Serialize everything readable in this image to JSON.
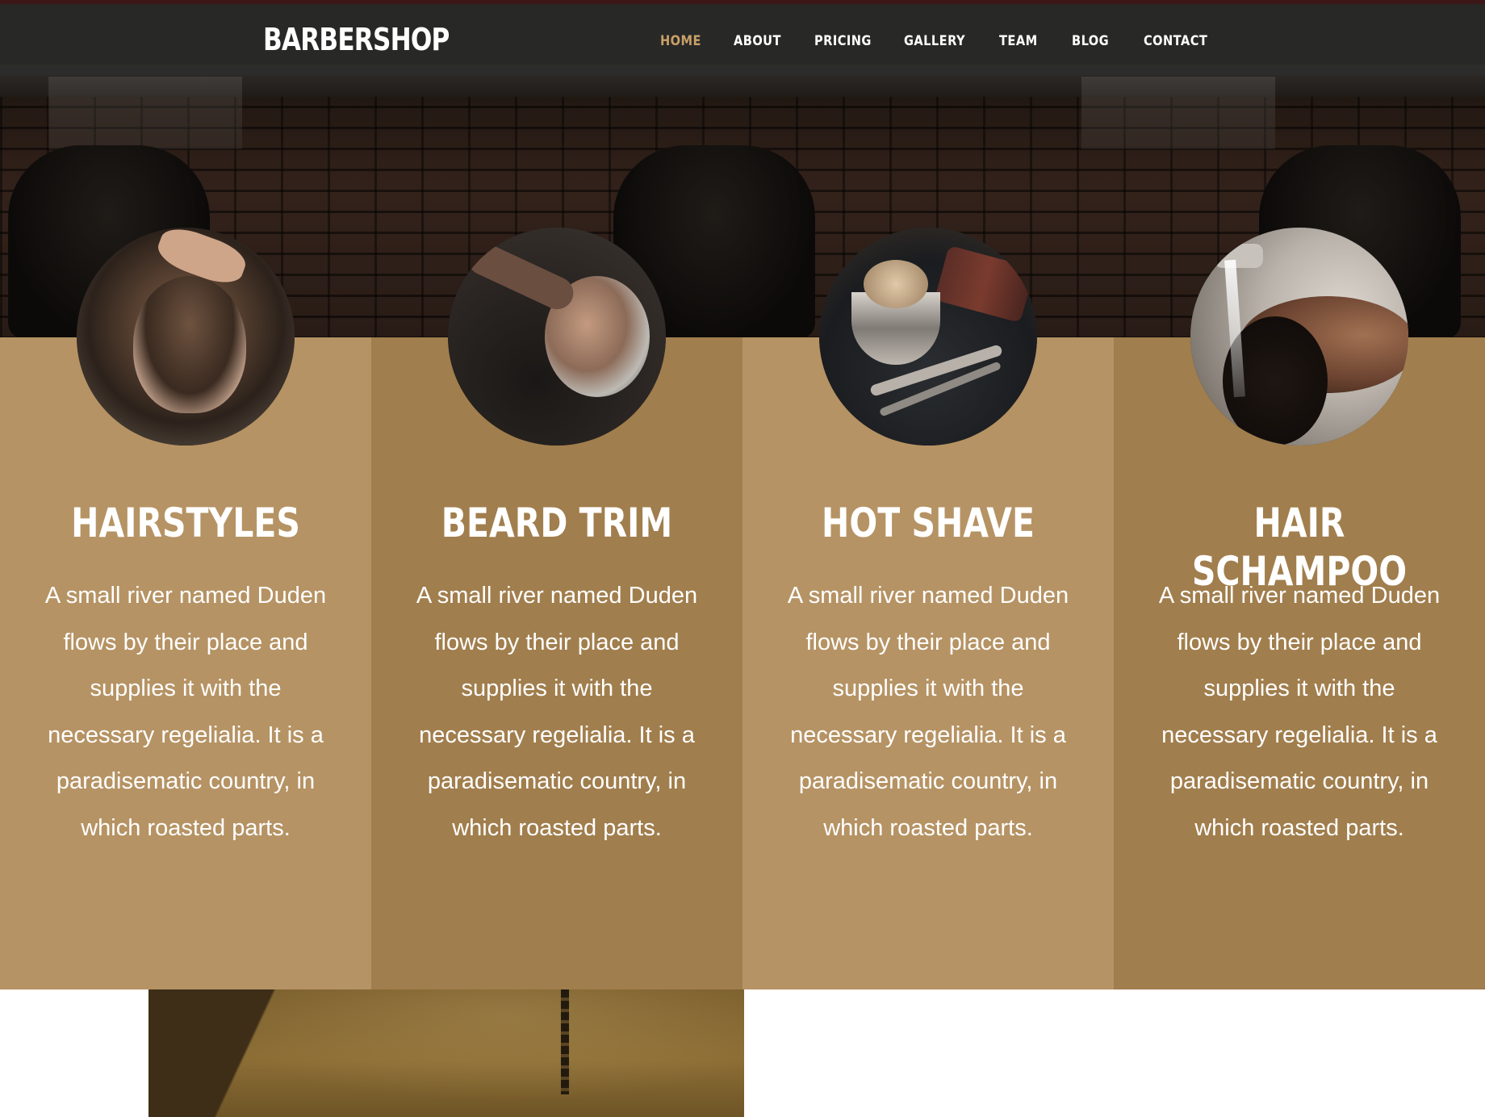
{
  "brand": "BARBERSHOP",
  "nav": {
    "items": [
      {
        "label": "HOME",
        "active": true
      },
      {
        "label": "ABOUT",
        "active": false
      },
      {
        "label": "PRICING",
        "active": false
      },
      {
        "label": "GALLERY",
        "active": false
      },
      {
        "label": "TEAM",
        "active": false
      },
      {
        "label": "BLOG",
        "active": false
      },
      {
        "label": "CONTACT",
        "active": false
      }
    ]
  },
  "services": [
    {
      "title": "HAIRSTYLES",
      "text": "A small river named Duden flows by their place and supplies it with the necessary regelialia. It is a paradisematic country, in which roasted parts.",
      "image": "haircut-photo"
    },
    {
      "title": "BEARD TRIM",
      "text": "A small river named Duden flows by their place and supplies it with the necessary regelialia. It is a paradisematic country, in which roasted parts.",
      "image": "beard-trim-photo"
    },
    {
      "title": "HOT SHAVE",
      "text": "A small river named Duden flows by their place and supplies it with the necessary regelialia. It is a paradisematic country, in which roasted parts.",
      "image": "shaving-tools-photo"
    },
    {
      "title": "HAIR SCHAMPOO",
      "text": "A small river named Duden flows by their place and supplies it with the necessary regelialia. It is a paradisematic country, in which roasted parts.",
      "image": "hair-wash-photo"
    }
  ],
  "colors": {
    "accent": "#c8a067",
    "column_light": "#b69364",
    "column_dark": "#a17e4d",
    "nav_bg": "#2d2d2d"
  }
}
